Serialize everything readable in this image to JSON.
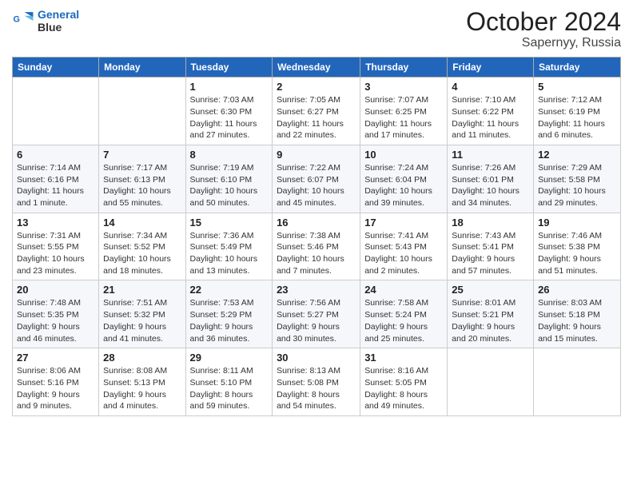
{
  "header": {
    "logo_line1": "General",
    "logo_line2": "Blue",
    "month": "October 2024",
    "location": "Sapernyy, Russia"
  },
  "weekdays": [
    "Sunday",
    "Monday",
    "Tuesday",
    "Wednesday",
    "Thursday",
    "Friday",
    "Saturday"
  ],
  "weeks": [
    [
      {
        "day": "",
        "sunrise": "",
        "sunset": "",
        "daylight": ""
      },
      {
        "day": "",
        "sunrise": "",
        "sunset": "",
        "daylight": ""
      },
      {
        "day": "1",
        "sunrise": "Sunrise: 7:03 AM",
        "sunset": "Sunset: 6:30 PM",
        "daylight": "Daylight: 11 hours and 27 minutes."
      },
      {
        "day": "2",
        "sunrise": "Sunrise: 7:05 AM",
        "sunset": "Sunset: 6:27 PM",
        "daylight": "Daylight: 11 hours and 22 minutes."
      },
      {
        "day": "3",
        "sunrise": "Sunrise: 7:07 AM",
        "sunset": "Sunset: 6:25 PM",
        "daylight": "Daylight: 11 hours and 17 minutes."
      },
      {
        "day": "4",
        "sunrise": "Sunrise: 7:10 AM",
        "sunset": "Sunset: 6:22 PM",
        "daylight": "Daylight: 11 hours and 11 minutes."
      },
      {
        "day": "5",
        "sunrise": "Sunrise: 7:12 AM",
        "sunset": "Sunset: 6:19 PM",
        "daylight": "Daylight: 11 hours and 6 minutes."
      }
    ],
    [
      {
        "day": "6",
        "sunrise": "Sunrise: 7:14 AM",
        "sunset": "Sunset: 6:16 PM",
        "daylight": "Daylight: 11 hours and 1 minute."
      },
      {
        "day": "7",
        "sunrise": "Sunrise: 7:17 AM",
        "sunset": "Sunset: 6:13 PM",
        "daylight": "Daylight: 10 hours and 55 minutes."
      },
      {
        "day": "8",
        "sunrise": "Sunrise: 7:19 AM",
        "sunset": "Sunset: 6:10 PM",
        "daylight": "Daylight: 10 hours and 50 minutes."
      },
      {
        "day": "9",
        "sunrise": "Sunrise: 7:22 AM",
        "sunset": "Sunset: 6:07 PM",
        "daylight": "Daylight: 10 hours and 45 minutes."
      },
      {
        "day": "10",
        "sunrise": "Sunrise: 7:24 AM",
        "sunset": "Sunset: 6:04 PM",
        "daylight": "Daylight: 10 hours and 39 minutes."
      },
      {
        "day": "11",
        "sunrise": "Sunrise: 7:26 AM",
        "sunset": "Sunset: 6:01 PM",
        "daylight": "Daylight: 10 hours and 34 minutes."
      },
      {
        "day": "12",
        "sunrise": "Sunrise: 7:29 AM",
        "sunset": "Sunset: 5:58 PM",
        "daylight": "Daylight: 10 hours and 29 minutes."
      }
    ],
    [
      {
        "day": "13",
        "sunrise": "Sunrise: 7:31 AM",
        "sunset": "Sunset: 5:55 PM",
        "daylight": "Daylight: 10 hours and 23 minutes."
      },
      {
        "day": "14",
        "sunrise": "Sunrise: 7:34 AM",
        "sunset": "Sunset: 5:52 PM",
        "daylight": "Daylight: 10 hours and 18 minutes."
      },
      {
        "day": "15",
        "sunrise": "Sunrise: 7:36 AM",
        "sunset": "Sunset: 5:49 PM",
        "daylight": "Daylight: 10 hours and 13 minutes."
      },
      {
        "day": "16",
        "sunrise": "Sunrise: 7:38 AM",
        "sunset": "Sunset: 5:46 PM",
        "daylight": "Daylight: 10 hours and 7 minutes."
      },
      {
        "day": "17",
        "sunrise": "Sunrise: 7:41 AM",
        "sunset": "Sunset: 5:43 PM",
        "daylight": "Daylight: 10 hours and 2 minutes."
      },
      {
        "day": "18",
        "sunrise": "Sunrise: 7:43 AM",
        "sunset": "Sunset: 5:41 PM",
        "daylight": "Daylight: 9 hours and 57 minutes."
      },
      {
        "day": "19",
        "sunrise": "Sunrise: 7:46 AM",
        "sunset": "Sunset: 5:38 PM",
        "daylight": "Daylight: 9 hours and 51 minutes."
      }
    ],
    [
      {
        "day": "20",
        "sunrise": "Sunrise: 7:48 AM",
        "sunset": "Sunset: 5:35 PM",
        "daylight": "Daylight: 9 hours and 46 minutes."
      },
      {
        "day": "21",
        "sunrise": "Sunrise: 7:51 AM",
        "sunset": "Sunset: 5:32 PM",
        "daylight": "Daylight: 9 hours and 41 minutes."
      },
      {
        "day": "22",
        "sunrise": "Sunrise: 7:53 AM",
        "sunset": "Sunset: 5:29 PM",
        "daylight": "Daylight: 9 hours and 36 minutes."
      },
      {
        "day": "23",
        "sunrise": "Sunrise: 7:56 AM",
        "sunset": "Sunset: 5:27 PM",
        "daylight": "Daylight: 9 hours and 30 minutes."
      },
      {
        "day": "24",
        "sunrise": "Sunrise: 7:58 AM",
        "sunset": "Sunset: 5:24 PM",
        "daylight": "Daylight: 9 hours and 25 minutes."
      },
      {
        "day": "25",
        "sunrise": "Sunrise: 8:01 AM",
        "sunset": "Sunset: 5:21 PM",
        "daylight": "Daylight: 9 hours and 20 minutes."
      },
      {
        "day": "26",
        "sunrise": "Sunrise: 8:03 AM",
        "sunset": "Sunset: 5:18 PM",
        "daylight": "Daylight: 9 hours and 15 minutes."
      }
    ],
    [
      {
        "day": "27",
        "sunrise": "Sunrise: 8:06 AM",
        "sunset": "Sunset: 5:16 PM",
        "daylight": "Daylight: 9 hours and 9 minutes."
      },
      {
        "day": "28",
        "sunrise": "Sunrise: 8:08 AM",
        "sunset": "Sunset: 5:13 PM",
        "daylight": "Daylight: 9 hours and 4 minutes."
      },
      {
        "day": "29",
        "sunrise": "Sunrise: 8:11 AM",
        "sunset": "Sunset: 5:10 PM",
        "daylight": "Daylight: 8 hours and 59 minutes."
      },
      {
        "day": "30",
        "sunrise": "Sunrise: 8:13 AM",
        "sunset": "Sunset: 5:08 PM",
        "daylight": "Daylight: 8 hours and 54 minutes."
      },
      {
        "day": "31",
        "sunrise": "Sunrise: 8:16 AM",
        "sunset": "Sunset: 5:05 PM",
        "daylight": "Daylight: 8 hours and 49 minutes."
      },
      {
        "day": "",
        "sunrise": "",
        "sunset": "",
        "daylight": ""
      },
      {
        "day": "",
        "sunrise": "",
        "sunset": "",
        "daylight": ""
      }
    ]
  ]
}
